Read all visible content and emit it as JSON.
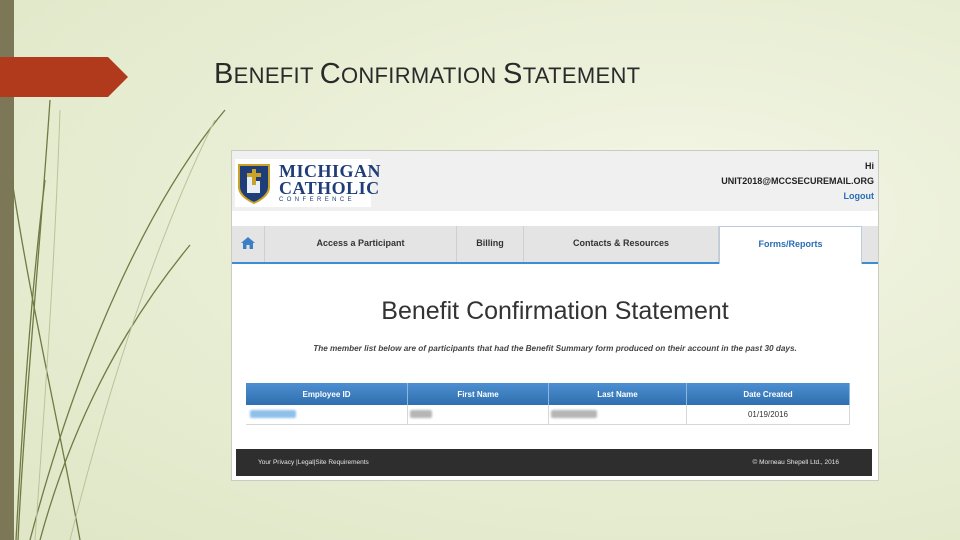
{
  "slide": {
    "title_parts": [
      {
        "cap": "B",
        "rest": "ENEFIT "
      },
      {
        "cap": "C",
        "rest": "ONFIRMATION "
      },
      {
        "cap": "S",
        "rest": "TATEMENT"
      }
    ],
    "accent_color": "#b03a1b"
  },
  "logo": {
    "line1": "MICHIGAN",
    "line2": "CATHOLIC",
    "line3": "CONFERENCE"
  },
  "user": {
    "greeting": "Hi",
    "email": "UNIT2018@MCCSECUREMAIL.ORG",
    "logout_label": "Logout"
  },
  "nav": {
    "home_icon": "home-icon",
    "items": [
      {
        "label": "Access a Participant"
      },
      {
        "label": "Billing"
      },
      {
        "label": "Contacts & Resources"
      },
      {
        "label": "Forms/Reports",
        "active": true
      }
    ]
  },
  "page": {
    "title": "Benefit Confirmation Statement",
    "description": "The member list below are of participants that had the Benefit Summary form produced on their account in the past 30 days."
  },
  "table": {
    "columns": [
      "Employee ID",
      "First Name",
      "Last Name",
      "Date Created"
    ],
    "rows": [
      {
        "date_created": "01/19/2016"
      }
    ]
  },
  "footer": {
    "left": "Your Privacy |Legal|Site Requirements",
    "right": "© Morneau Shepell Ltd., 2016"
  }
}
